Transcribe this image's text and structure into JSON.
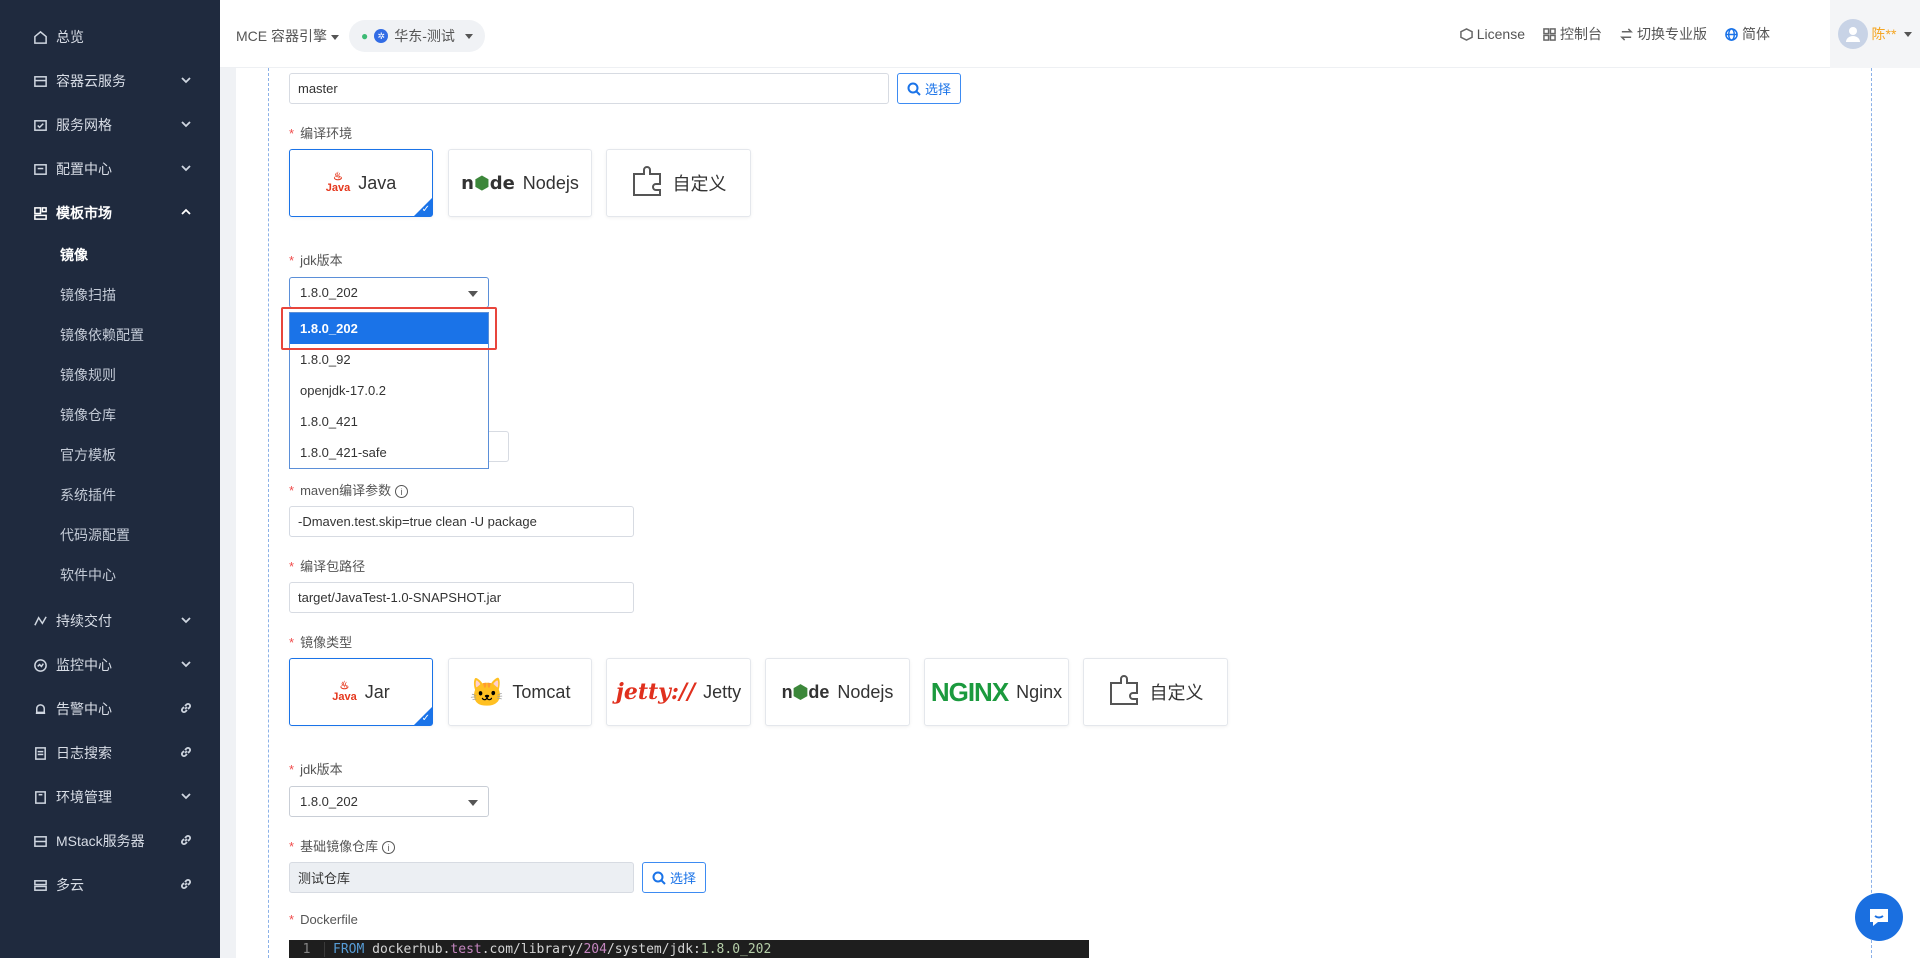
{
  "sidebar": {
    "items": [
      {
        "label": "总览",
        "icon": "home-icon",
        "arrow": "none"
      },
      {
        "label": "容器云服务",
        "icon": "box-icon",
        "arrow": "down"
      },
      {
        "label": "服务网格",
        "icon": "mesh-icon",
        "arrow": "down"
      },
      {
        "label": "配置中心",
        "icon": "config-icon",
        "arrow": "down"
      },
      {
        "label": "模板市场",
        "icon": "template-icon",
        "arrow": "up"
      }
    ],
    "sub_items": [
      "镜像",
      "镜像扫描",
      "镜像依赖配置",
      "镜像规则",
      "镜像仓库",
      "官方模板",
      "系统插件",
      "代码源配置",
      "软件中心"
    ],
    "items_bottom": [
      {
        "label": "持续交付",
        "icon": "delivery-icon",
        "arrow": "down"
      },
      {
        "label": "监控中心",
        "icon": "monitor-icon",
        "arrow": "down"
      },
      {
        "label": "告警中心",
        "icon": "alarm-icon",
        "arrow": "link"
      },
      {
        "label": "日志搜索",
        "icon": "log-icon",
        "arrow": "link"
      },
      {
        "label": "环境管理",
        "icon": "env-icon",
        "arrow": "down"
      },
      {
        "label": "MStack服务器",
        "icon": "server-icon",
        "arrow": "link"
      },
      {
        "label": "多云",
        "icon": "cloud-icon",
        "arrow": "link"
      }
    ]
  },
  "topbar": {
    "engine": "MCE 容器引擎",
    "cluster": "华东-测试",
    "links": [
      "License",
      "控制台",
      "切换专业版",
      "简体"
    ],
    "user": "陈**"
  },
  "form": {
    "branch_value": "master",
    "choose_label": "选择",
    "compile_env_label": "编译环境",
    "compile_env": [
      "Java",
      "Nodejs",
      "自定义"
    ],
    "jdk_label": "jdk版本",
    "jdk_value": "1.8.0_202",
    "jdk_options": [
      "1.8.0_202",
      "1.8.0_92",
      "openjdk-17.0.2",
      "1.8.0_421",
      "1.8.0_421-safe"
    ],
    "maven_label": "maven编译参数",
    "maven_value": "-Dmaven.test.skip=true clean -U package",
    "package_path_label": "编译包路径",
    "package_path_value": "target/JavaTest-1.0-SNAPSHOT.jar",
    "image_type_label": "镜像类型",
    "image_types": [
      "Jar",
      "Tomcat",
      "Jetty",
      "Nodejs",
      "Nginx",
      "自定义"
    ],
    "jdk_label2": "jdk版本",
    "jdk_value2": "1.8.0_202",
    "base_repo_label": "基础镜像仓库",
    "base_repo_value": "测试仓库",
    "dockerfile_label": "Dockerfile",
    "dockerfile_line_no": "1",
    "dockerfile_line": {
      "kw": "FROM",
      "host_pre": "dockerhub.",
      "host_test": "test",
      "host_post": ".com/library/",
      "n204": "204",
      "mid": "/system/jdk:",
      "ver": "1.8.0_202"
    }
  },
  "colors": {
    "sidebar_bg": "#1f2a3e",
    "accent": "#1a73e8",
    "required": "#f04b4b",
    "highlight_box": "#e8453c"
  }
}
